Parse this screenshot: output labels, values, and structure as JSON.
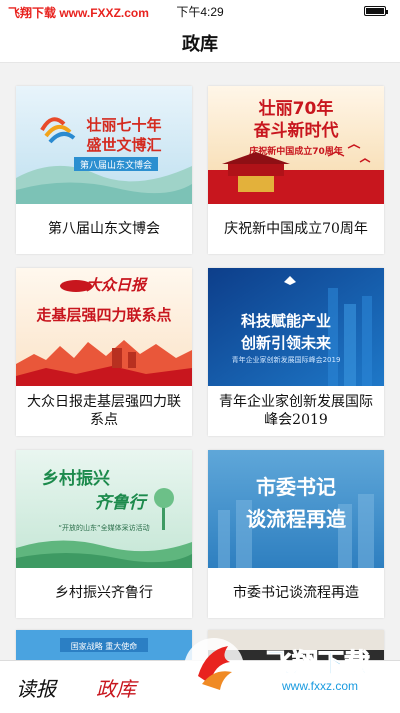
{
  "status_bar": {
    "watermark": "飞翔下载 www.FXXZ.com",
    "time": "下午4:29"
  },
  "header": {
    "title": "政库"
  },
  "cards": [
    {
      "caption": "第八届山东文博会",
      "banner_text": [
        "壮丽七十年",
        "盛世文博汇",
        "第八届山东文博会"
      ]
    },
    {
      "caption": "庆祝新中国成立70周年",
      "banner_text": [
        "壮丽70年",
        "奋斗新时代",
        "庆祝新中国成立70周年"
      ]
    },
    {
      "caption": "大众日报走基层强四力联系点",
      "banner_text": [
        "大众日报",
        "走基层强四力联系点"
      ]
    },
    {
      "caption": "青年企业家创新发展国际峰会2019",
      "banner_text": [
        "科技赋能产业",
        "创新引领未来",
        "青年企业家创新发展国际峰会2019"
      ]
    },
    {
      "caption": "乡村振兴齐鲁行",
      "banner_text": [
        "乡村振兴",
        "齐鲁行",
        "“开放的山东”全媒体采访活动"
      ]
    },
    {
      "caption": "市委书记谈流程再造",
      "banner_text": [
        "市委书记",
        "谈流程再造"
      ]
    },
    {
      "caption": "",
      "banner_text": [
        "国家战略 重大使命"
      ]
    }
  ],
  "tabs": [
    {
      "label": "读报",
      "active": false
    },
    {
      "label": "政库",
      "active": true
    }
  ],
  "watermark_bottom": {
    "title": "飞翔下载",
    "url": "www.fxxz.com"
  },
  "colors": {
    "active_tab": "#c8161e",
    "inactive_tab": "#111111",
    "watermark_red": "#e8231f",
    "watermark_blue": "#1a9be0"
  }
}
